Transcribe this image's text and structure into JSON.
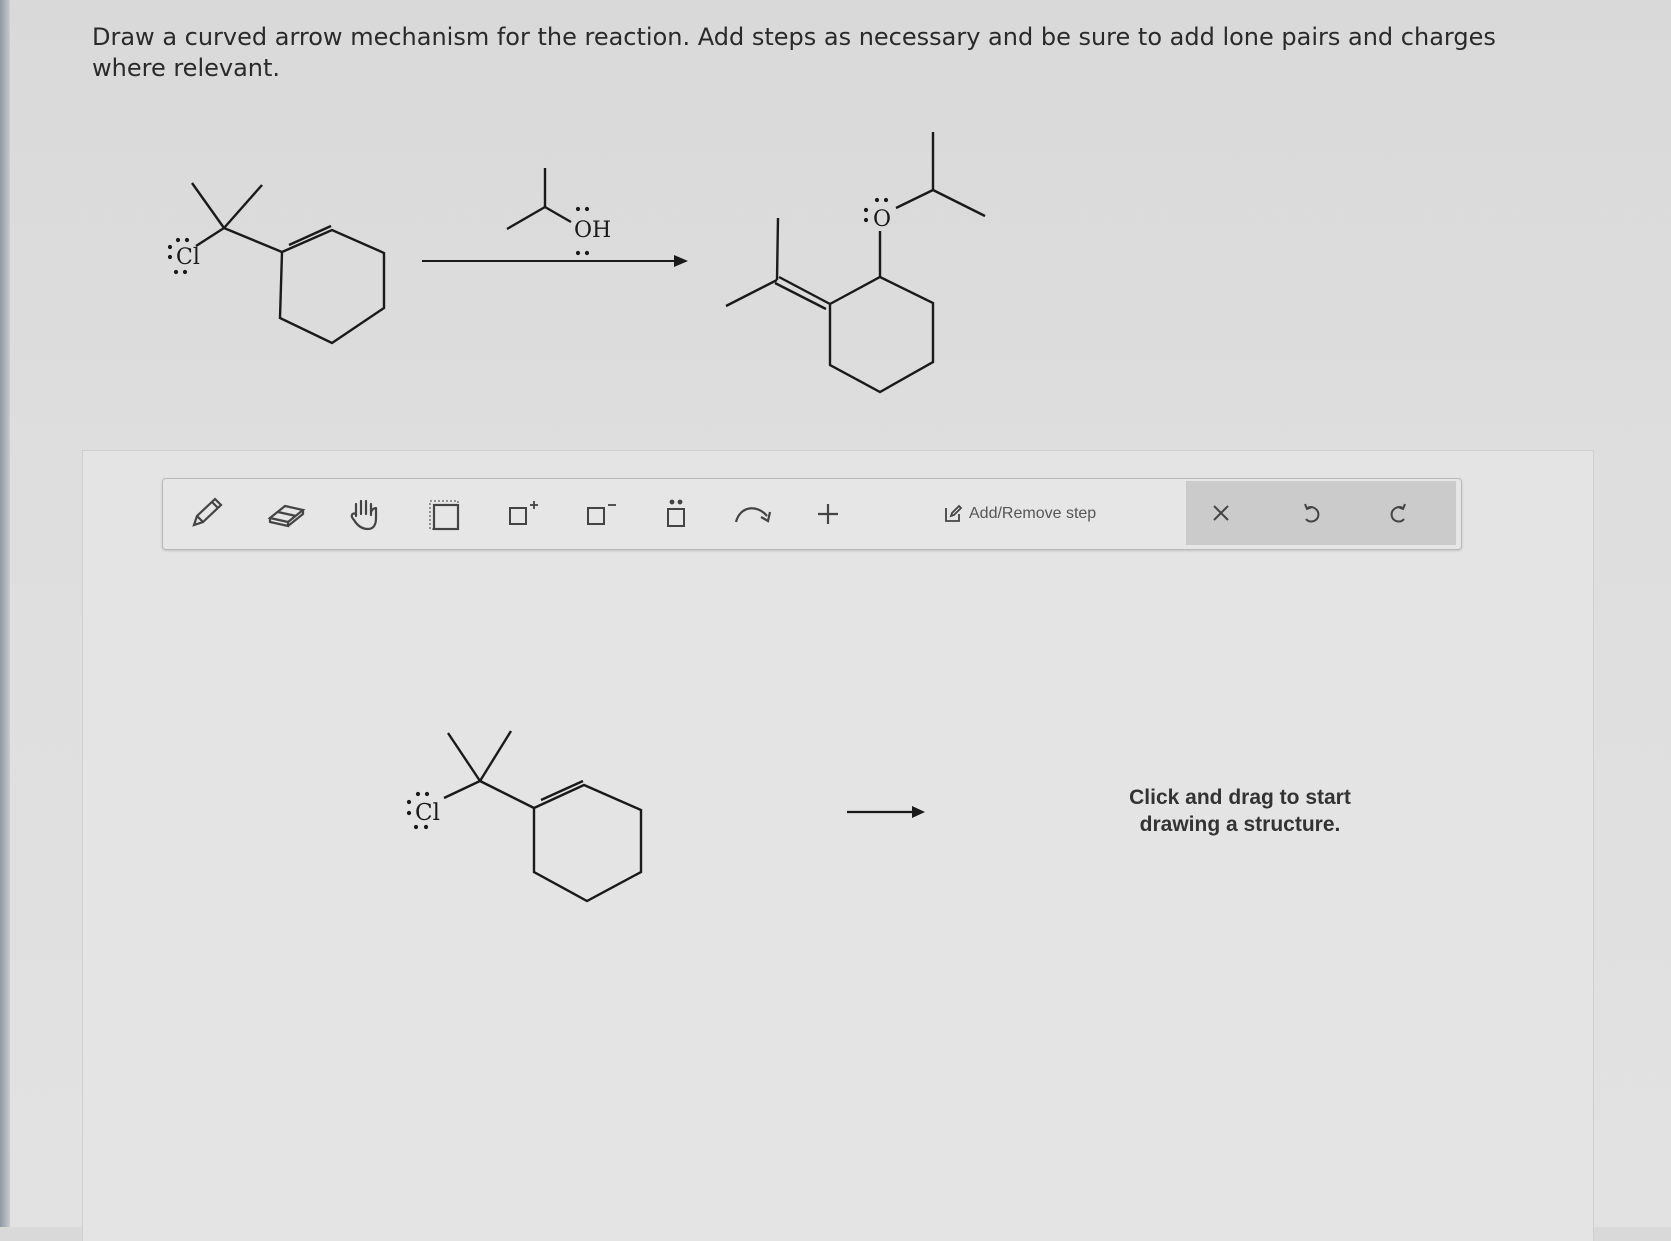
{
  "question": {
    "line1": "Draw a curved arrow mechanism for the reaction. Add steps as necessary and be sure to add lone pairs and charges",
    "line2": "where relevant."
  },
  "reaction": {
    "reactant_atom": "Cl",
    "reagent_atom": "OH",
    "product_atom": "O"
  },
  "toolbar": {
    "tools": [
      "pencil-icon",
      "eraser-icon",
      "hand-icon",
      "select-box-icon",
      "positive-charge-icon",
      "negative-charge-icon",
      "lone-pair-icon",
      "curved-arrow-icon",
      "plus-icon"
    ],
    "add_remove_step_label": "Add/Remove step",
    "actions": [
      "close-icon",
      "undo-icon",
      "redo-icon"
    ]
  },
  "canvas": {
    "start_atom": "Cl",
    "hint_line1": "Click and drag to start",
    "hint_line2": "drawing a structure."
  }
}
